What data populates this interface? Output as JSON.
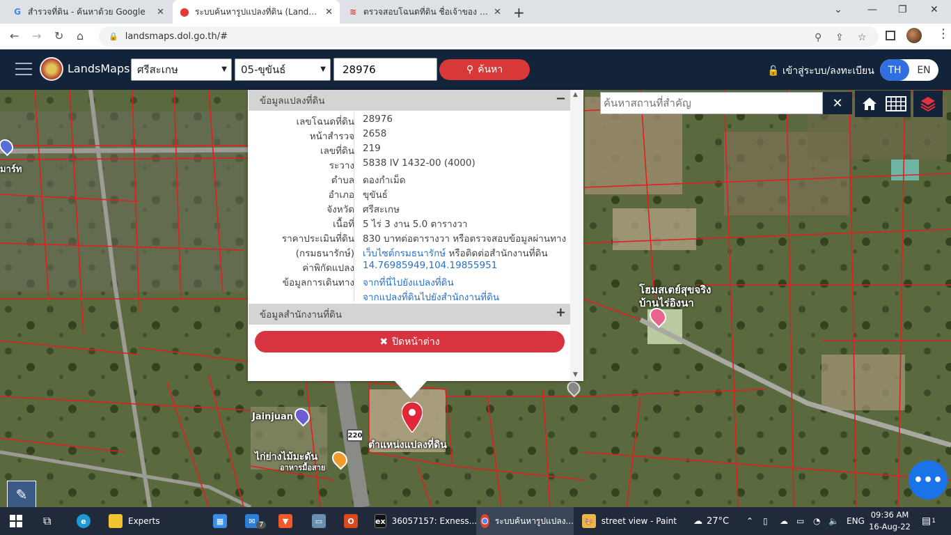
{
  "browser": {
    "tabs": [
      {
        "title": "สำรวจที่ดิน - ค้นหาด้วย Google",
        "icon": "google-icon"
      },
      {
        "title": "ระบบค้นหารูปแปลงที่ดิน (LandsMaps",
        "icon": "map-pin-icon"
      },
      {
        "title": "ตรวจสอบโฉนดที่ดิน ชื่อเจ้าของ ค้นหาแ",
        "icon": "stripes-logo-icon"
      }
    ],
    "url": "landsmaps.dol.go.th/#"
  },
  "header": {
    "brand": "LandsMaps",
    "province": "ศรีสะเกษ",
    "district": "05-ขุขันธ์",
    "parcel_no": "28976",
    "search_label": "ค้นหา",
    "login_label": "เข้าสู่ระบบ/ลงทะเบียน",
    "lang_th": "TH",
    "lang_en": "EN"
  },
  "popup": {
    "section1_title": "ข้อมูลแปลงที่ดิน",
    "section2_title": "ข้อมูลสำนักงานที่ดิน",
    "rows": [
      {
        "key": "เลขโฉนดที่ดิน",
        "value": "28976"
      },
      {
        "key": "หน้าสำรวจ",
        "value": "2658"
      },
      {
        "key": "เลขที่ดิน",
        "value": "219"
      },
      {
        "key": "ระวาง",
        "value": "5838 IV 1432-00 (4000)"
      },
      {
        "key": "ตำบล",
        "value": "ดองกำเม็ด"
      },
      {
        "key": "อำเภอ",
        "value": "ขุขันธ์"
      },
      {
        "key": "จังหวัด",
        "value": "ศรีสะเกษ"
      },
      {
        "key": "เนื้อที่",
        "value": "5 ไร่ 3 งาน 5.0 ตารางวา"
      },
      {
        "key": "ราคาประเมินที่ดิน",
        "value": "830 บาทต่อตารางวา หรือตรวจสอบข้อมูลผ่านทาง"
      },
      {
        "key": "(กรมธนารักษ์)",
        "value": "เว็บไซต์กรมธนารักษ์",
        "value_extra": " หรือติดต่อสำนักงานที่ดิน"
      },
      {
        "key": "ค่าพิกัดแปลง",
        "value": "14.76985949,104.19855951"
      },
      {
        "key": "ข้อมูลการเดินทาง",
        "value": "จากที่นี่ไปยังแปลงที่ดิน"
      },
      {
        "key": "",
        "value": "จากแปลงที่ดินไปยังสำนักงานที่ดิน"
      }
    ],
    "close_label": "ปิดหน้าต่าง"
  },
  "map": {
    "place_search_placeholder": "ค้นหาสถานที่สำคัญ",
    "labels": {
      "left_edge": "มาร์ท",
      "jainjuan": "Jainjuan",
      "road": "220",
      "restaurant": "ไก่ย่างไม้มะดัน",
      "restaurant_sub": "อาหารมื้อสาย",
      "marker": "ตำแหน่งแปลงที่ดิน",
      "homestay1": "โฮมสเตย์สุขจริง",
      "homestay2": "บ้านไร่อิงนา"
    }
  },
  "taskbar": {
    "items": [
      {
        "label": "Experts",
        "icon": "folder-icon"
      },
      {
        "label": "36057157: Exness...",
        "icon": "exness-icon"
      },
      {
        "label": "ระบบค้นหารูปแปลง...",
        "icon": "chrome-icon"
      },
      {
        "label": "street view - Paint",
        "icon": "paint-icon"
      }
    ],
    "mail_badge": "7",
    "weather": "27°C",
    "lang": "ENG",
    "time": "09:36 AM",
    "date": "16-Aug-22",
    "notif_count": "1"
  },
  "colors": {
    "header_bg": "#12233a",
    "accent_red": "#d83838",
    "link_blue": "#2a6fc8",
    "parcel_line": "#e02020"
  }
}
